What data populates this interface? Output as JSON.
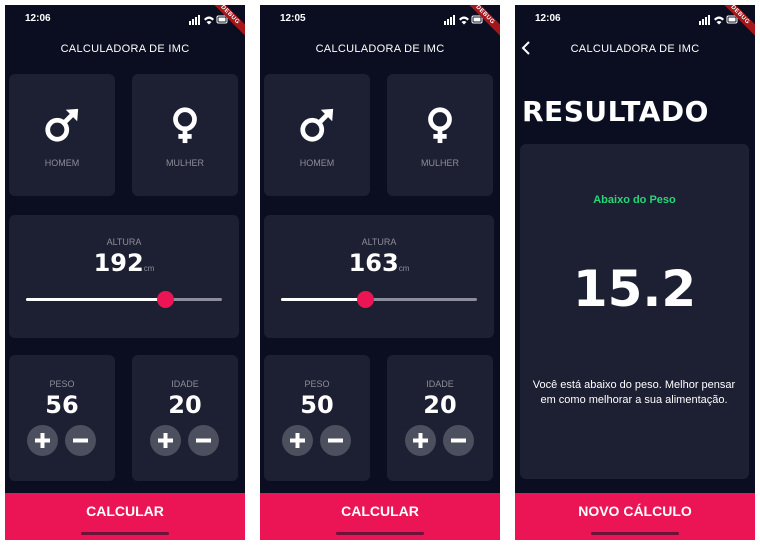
{
  "colors": {
    "background": "#0b0e21",
    "card": "#1d1f33",
    "accent": "#eb1555",
    "inactive_text": "#8d8e98",
    "status_green": "#24d876",
    "button_gray": "#4c4f5e"
  },
  "screens": [
    {
      "time": "12:06",
      "debug": "DEBUG",
      "title": "CALCULADORA DE IMC",
      "gender": {
        "male_label": "HOMEM",
        "female_label": "MULHER",
        "male_icon": "male-icon",
        "female_icon": "female-icon"
      },
      "height": {
        "label": "ALTURA",
        "value": "192",
        "unit": "cm",
        "slider_fraction": 0.71
      },
      "weight": {
        "label": "PESO",
        "value": "56"
      },
      "age": {
        "label": "IDADE",
        "value": "20"
      },
      "button": "CALCULAR"
    },
    {
      "time": "12:05",
      "debug": "DEBUG",
      "title": "CALCULADORA DE IMC",
      "gender": {
        "male_label": "HOMEM",
        "female_label": "MULHER",
        "male_icon": "male-icon",
        "female_icon": "female-icon"
      },
      "height": {
        "label": "ALTURA",
        "value": "163",
        "unit": "cm",
        "slider_fraction": 0.43
      },
      "weight": {
        "label": "PESO",
        "value": "50"
      },
      "age": {
        "label": "IDADE",
        "value": "20"
      },
      "button": "CALCULAR"
    },
    {
      "time": "12:06",
      "debug": "DEBUG",
      "title": "CALCULADORA DE IMC",
      "back_icon": "chevron-left-icon",
      "heading": "RESULTADO",
      "status": "Abaixo do Peso",
      "bmi": "15.2",
      "message": "Você está abaixo do peso. Melhor pensar em como melhorar a sua alimentação.",
      "button": "NOVO CÁLCULO"
    }
  ]
}
